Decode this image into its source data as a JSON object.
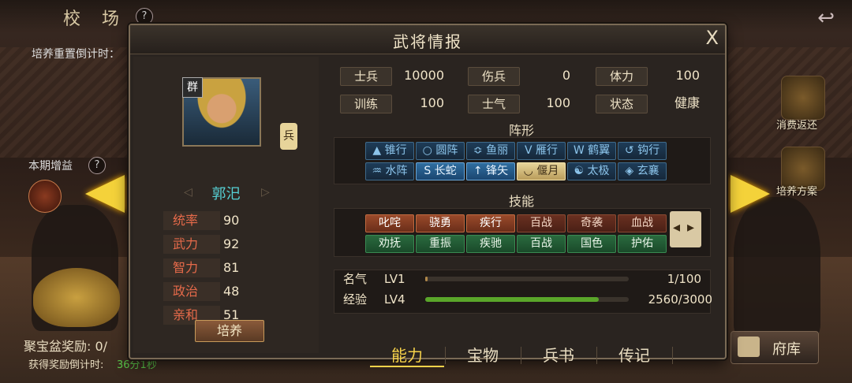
{
  "scene": {
    "title": "校 场",
    "help": "?",
    "reset_countdown": "培养重置倒计时：",
    "period_bonus": "本期增益",
    "treasure_reward": "聚宝盆奖励: 0/",
    "reward_countdown_label": "获得奖励倒计时:",
    "reward_countdown": "36分1秒",
    "right_buttons": [
      {
        "label": "消费返还",
        "icon": "rebate-icon"
      },
      {
        "label": "培养方案",
        "icon": "plan-icon"
      }
    ],
    "bottom_button": "府库"
  },
  "modal": {
    "title": "武将情报",
    "close": "X",
    "general": {
      "faction": "群",
      "type": "兵",
      "name": "郭汜",
      "stats": [
        {
          "label": "统率",
          "value": "90"
        },
        {
          "label": "武力",
          "value": "92"
        },
        {
          "label": "智力",
          "value": "81"
        },
        {
          "label": "政治",
          "value": "48"
        },
        {
          "label": "亲和",
          "value": "51"
        }
      ],
      "cultivate": "培养"
    },
    "info": [
      {
        "label": "士兵",
        "value": "10000"
      },
      {
        "label": "伤兵",
        "value": "0"
      },
      {
        "label": "体力",
        "value": "100"
      },
      {
        "label": "训练",
        "value": "100"
      },
      {
        "label": "士气",
        "value": "100"
      },
      {
        "label": "状态",
        "value": "健康"
      }
    ],
    "formation_title": "阵形",
    "formations": [
      {
        "label": "锥行",
        "glyph": "▲",
        "state": "normal"
      },
      {
        "label": "圆阵",
        "glyph": "○",
        "state": "normal"
      },
      {
        "label": "鱼丽",
        "glyph": "≎",
        "state": "normal"
      },
      {
        "label": "雁行",
        "glyph": "V",
        "state": "normal"
      },
      {
        "label": "鹤翼",
        "glyph": "W",
        "state": "normal"
      },
      {
        "label": "钩行",
        "glyph": "↺",
        "state": "normal"
      },
      {
        "label": "水阵",
        "glyph": "♒",
        "state": "normal"
      },
      {
        "label": "长蛇",
        "glyph": "S",
        "state": "blue"
      },
      {
        "label": "锋矢",
        "glyph": "↑",
        "state": "blue"
      },
      {
        "label": "偃月",
        "glyph": "◡",
        "state": "gold"
      },
      {
        "label": "太极",
        "glyph": "☯",
        "state": "normal"
      },
      {
        "label": "玄襄",
        "glyph": "◈",
        "state": "normal"
      }
    ],
    "skill_title": "技能",
    "skills": [
      {
        "label": "叱咤",
        "color": "red",
        "lit": true
      },
      {
        "label": "骁勇",
        "color": "red",
        "lit": true
      },
      {
        "label": "疾行",
        "color": "red",
        "lit": true
      },
      {
        "label": "百战",
        "color": "red",
        "lit": false
      },
      {
        "label": "奇袭",
        "color": "red",
        "lit": false
      },
      {
        "label": "血战",
        "color": "red",
        "lit": false
      },
      {
        "label": "劝抚",
        "color": "green",
        "lit": true
      },
      {
        "label": "重振",
        "color": "green",
        "lit": true
      },
      {
        "label": "疾驰",
        "color": "green",
        "lit": true
      },
      {
        "label": "百战",
        "color": "green",
        "lit": true
      },
      {
        "label": "国色",
        "color": "green",
        "lit": true
      },
      {
        "label": "护佑",
        "color": "green",
        "lit": true
      }
    ],
    "fame": {
      "label": "名气",
      "level": "LV1",
      "value": "1/100",
      "progress": 0.01
    },
    "exp": {
      "label": "经验",
      "level": "LV4",
      "value": "2560/3000",
      "progress": 0.853
    },
    "tabs": [
      "能力",
      "宝物",
      "兵书",
      "传记"
    ],
    "active_tab": 0
  }
}
